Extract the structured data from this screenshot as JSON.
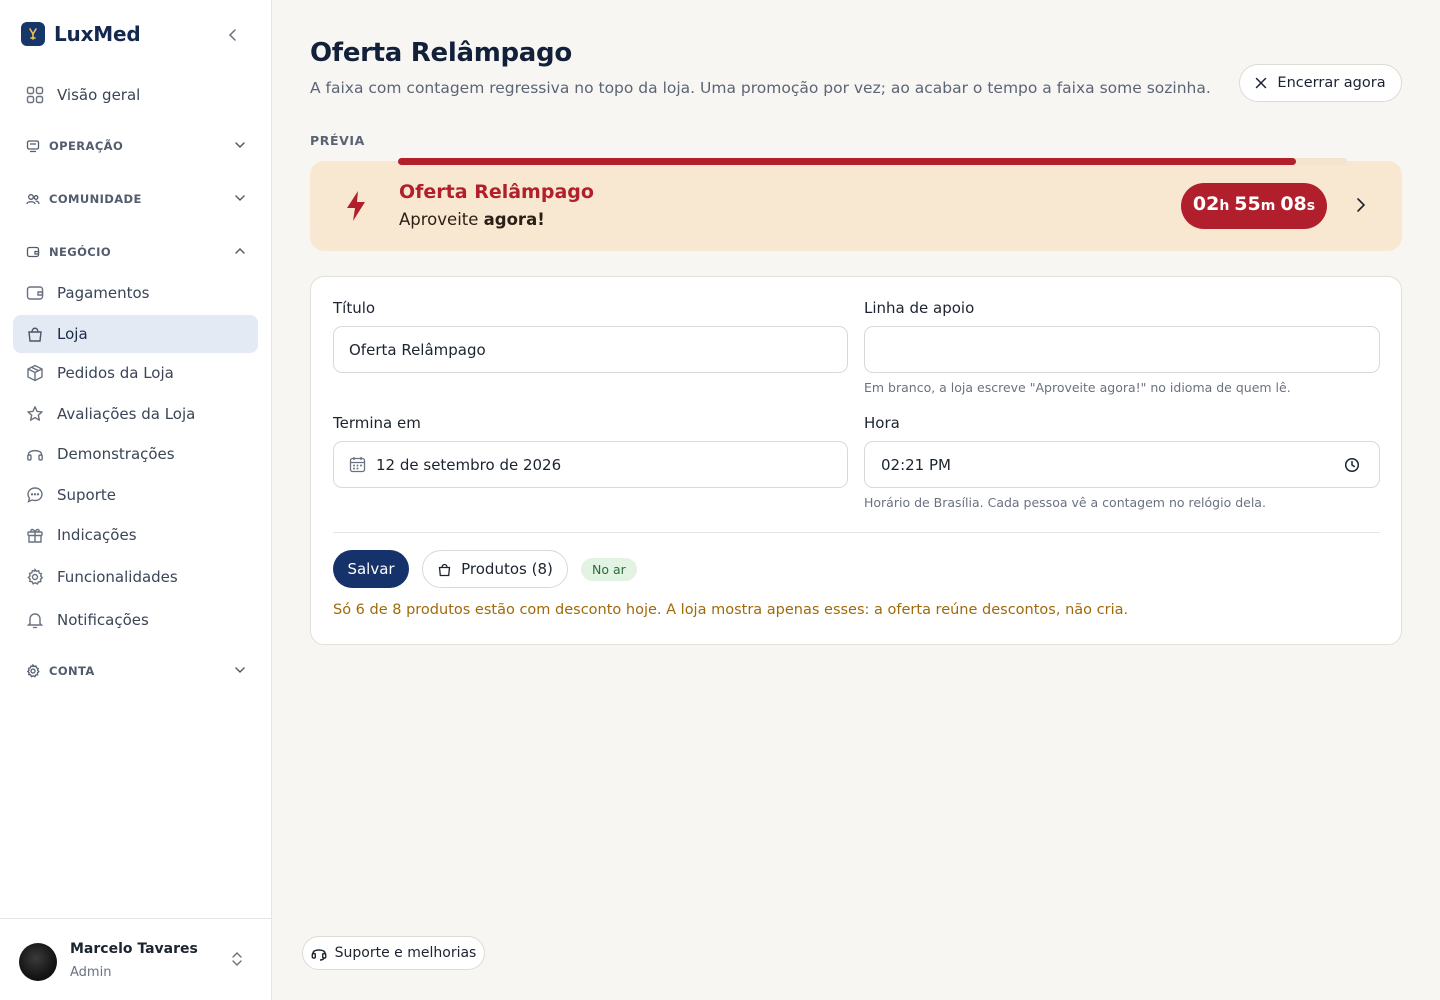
{
  "brand": {
    "name": "LuxMed"
  },
  "sidebar": {
    "overview": "Visão geral",
    "sections": {
      "operacao": "OPERAÇÃO",
      "comunidade": "COMUNIDADE",
      "negocio": "NEGÓCIO",
      "conta": "CONTA"
    },
    "items": [
      {
        "label": "Pagamentos"
      },
      {
        "label": "Loja"
      },
      {
        "label": "Pedidos da Loja"
      },
      {
        "label": "Avaliações da Loja"
      },
      {
        "label": "Demonstrações"
      },
      {
        "label": "Suporte"
      },
      {
        "label": "Indicações"
      },
      {
        "label": "Funcionalidades"
      },
      {
        "label": "Notificações"
      }
    ],
    "active_item": "Loja"
  },
  "user": {
    "name": "Marcelo Tavares",
    "role": "Admin"
  },
  "page": {
    "title": "Oferta Relâmpago",
    "subtitle": "A faixa com contagem regressiva no topo da loja. Uma promoção por vez; ao acabar o tempo a faixa some sozinha.",
    "end_button": "Encerrar agora",
    "preview_label": "PRÉVIA"
  },
  "banner": {
    "title": "Oferta Relâmpago",
    "subtitle_prefix": "Aproveite ",
    "subtitle_bold": "agora!",
    "progress": 0.946,
    "timer": {
      "hours": "02",
      "h_unit": "h",
      "minutes": "55",
      "m_unit": "m",
      "seconds": "08",
      "s_unit": "s"
    }
  },
  "form": {
    "title_label": "Título",
    "title_value": "Oferta Relâmpago",
    "tagline_label": "Linha de apoio",
    "tagline_value": "",
    "tagline_hint": "Em branco, a loja escreve \"Aproveite agora!\" no idioma de quem lê.",
    "ends_label": "Termina em",
    "ends_value": "12 de setembro de 2026",
    "time_label": "Hora",
    "time_value": "02:21 PM",
    "time_hint": "Horário de Brasília. Cada pessoa vê a contagem no relógio dela.",
    "save_button": "Salvar",
    "products_button": "Produtos (8)",
    "status_badge": "No ar",
    "warning": "Só 6 de 8 produtos estão com desconto hoje. A loja mostra apenas esses: a oferta reúne descontos, não cria."
  },
  "footer": {
    "support_button": "Suporte e melhorias"
  },
  "colors": {
    "primary": "#15336a",
    "accent_red": "#b01f2b",
    "banner_bg": "#f9e8d1",
    "active_nav": "#e4eaf3",
    "warning": "#a06a0a"
  }
}
